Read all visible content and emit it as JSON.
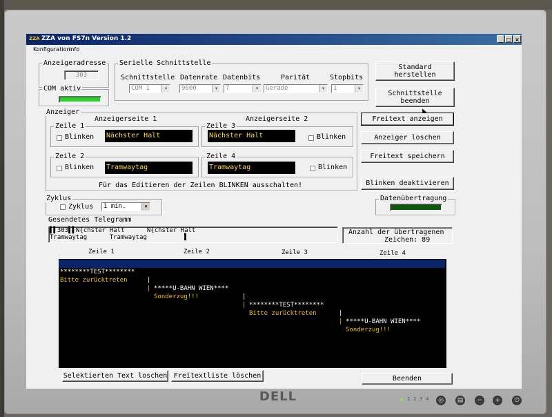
{
  "window": {
    "app_icon": "ZZA",
    "title": "ZZA von FS7n   Version 1.2",
    "minimize": "_",
    "maximize": "□",
    "close": "×"
  },
  "menu": {
    "items": [
      "Konfiguration",
      "Info"
    ]
  },
  "anzeigeradresse": {
    "legend": "Anzeigeradresse",
    "value": "303"
  },
  "com": {
    "legend": "COM aktiv",
    "indicator_color": "#28d228"
  },
  "serial": {
    "legend": "Serielle Schnittstelle",
    "headers": [
      "Schnittstelle",
      "Datenrate",
      "Datenbits",
      "Parität",
      "Stopbits"
    ],
    "values": [
      "COM 1",
      "9600",
      "7",
      "Gerade",
      "1"
    ]
  },
  "buttons_right": {
    "standard": "Standard\nherstellen",
    "end_interface": "Schnittstelle\nbeenden",
    "show_freetext": "Freitext anzeigen",
    "clear_display": "Anzeiger loschen",
    "save_freetext": "Freitext speichern",
    "blink_off": "Blinken deaktivieren",
    "quit": "Beenden"
  },
  "anzeiger": {
    "legend": "Anzeiger",
    "page1": "Anzeigerseite 1",
    "page2": "Anzeigerseite 2",
    "rows": [
      {
        "legend": "Zeile 1",
        "text": "Nächster Halt",
        "blink_label": "Blinken"
      },
      {
        "legend": "Zeile 3",
        "text": "Nächster Halt",
        "blink_label": "Blinken"
      },
      {
        "legend": "Zeile 2",
        "text": "Tramwaytag",
        "blink_label": "Blinken"
      },
      {
        "legend": "Zeile 4",
        "text": "Tramwaytag",
        "blink_label": "Blinken"
      }
    ],
    "hint": "Für das Editieren der Zeilen BLINKEN ausschalten!"
  },
  "zyklus": {
    "legend": "Zyklus",
    "checkbox_label": "Zyklus",
    "interval": "1 min."
  },
  "datenuebertragung": {
    "legend": "Datenübertragung",
    "indicator_color": "#0a5a0a"
  },
  "telegramm": {
    "label": "Gesendetes Telegramm",
    "line1": "▌▌303▌▌N{chster Halt      N{chster Halt",
    "line2": "Tramwaytag      Tramwaytag          ▌",
    "count_label": "Anzahl der übertragenen",
    "count_value": "Zeichen: 89"
  },
  "list": {
    "headers": [
      "Zeile 1",
      "Zeile 2",
      "Zeile 3",
      "Zeile 4"
    ],
    "rows": [
      [
        "********TEST********",
        "*****U-BAHN WIEN****",
        "********TEST********",
        "*****U-BAHN WIEN****"
      ],
      [
        "Bitte zurücktreten",
        "Sonderzug!!!",
        "Bitte zurücktreten",
        "Sonderzug!!!"
      ]
    ],
    "separator": "|"
  },
  "bottom_buttons": {
    "delete_selected": "Selektierten Text loschen",
    "delete_list": "Freitextliste löschen"
  },
  "monitor": {
    "brand": "DELL",
    "button_numbers": [
      "1",
      "2",
      "3",
      "4"
    ]
  }
}
